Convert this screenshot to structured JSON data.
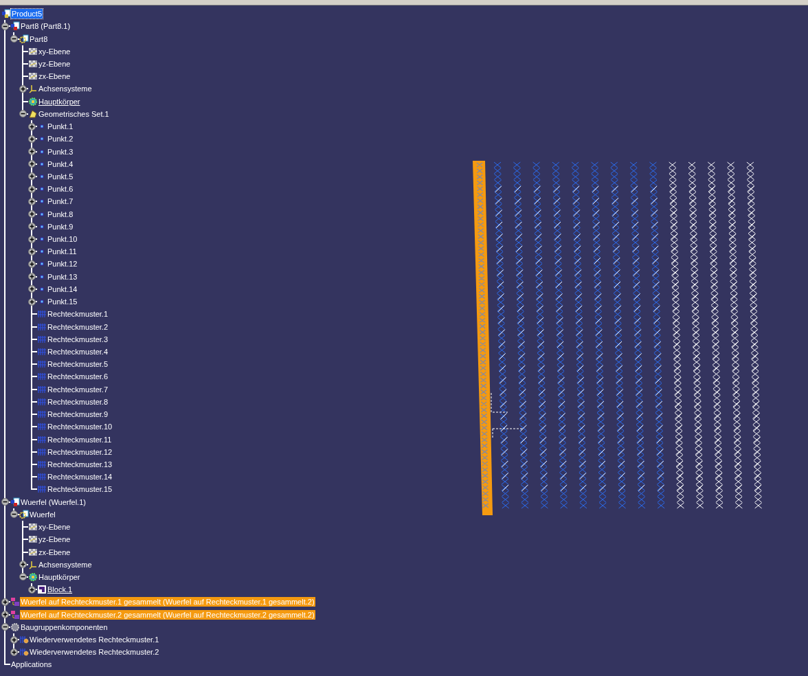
{
  "tree": [
    {
      "label": "Product5",
      "kind": "product",
      "selected": true,
      "children": [
        {
          "label": "Part8 (Part8.1)",
          "kind": "product-part",
          "expanded": true,
          "selected": false,
          "children": [
            {
              "label": "Part8",
              "kind": "part",
              "expanded": true,
              "selected": false,
              "children": [
                {
                  "label": "xy-Ebene",
                  "kind": "plane",
                  "selected": false
                },
                {
                  "label": "yz-Ebene",
                  "kind": "plane",
                  "selected": false
                },
                {
                  "label": "zx-Ebene",
                  "kind": "plane",
                  "selected": false
                },
                {
                  "label": "Achsensysteme",
                  "kind": "axis",
                  "expanded": false,
                  "selected": false
                },
                {
                  "label": "Hauptkörper",
                  "kind": "body",
                  "selected": false,
                  "underlined": true
                },
                {
                  "label": "Geometrisches Set.1",
                  "kind": "geoset",
                  "expanded": true,
                  "selected": false,
                  "children": [
                    {
                      "label": "Punkt.1",
                      "kind": "point",
                      "expanded": false,
                      "selected": false
                    },
                    {
                      "label": "Punkt.2",
                      "kind": "point",
                      "expanded": false,
                      "selected": false
                    },
                    {
                      "label": "Punkt.3",
                      "kind": "point",
                      "expanded": false,
                      "selected": false
                    },
                    {
                      "label": "Punkt.4",
                      "kind": "point",
                      "expanded": false,
                      "selected": false
                    },
                    {
                      "label": "Punkt.5",
                      "kind": "point",
                      "expanded": false,
                      "selected": false
                    },
                    {
                      "label": "Punkt.6",
                      "kind": "point",
                      "expanded": false,
                      "selected": false
                    },
                    {
                      "label": "Punkt.7",
                      "kind": "point",
                      "expanded": false,
                      "selected": false
                    },
                    {
                      "label": "Punkt.8",
                      "kind": "point",
                      "expanded": false,
                      "selected": false
                    },
                    {
                      "label": "Punkt.9",
                      "kind": "point",
                      "expanded": false,
                      "selected": false
                    },
                    {
                      "label": "Punkt.10",
                      "kind": "point",
                      "expanded": false,
                      "selected": false
                    },
                    {
                      "label": "Punkt.11",
                      "kind": "point",
                      "expanded": false,
                      "selected": false
                    },
                    {
                      "label": "Punkt.12",
                      "kind": "point",
                      "expanded": false,
                      "selected": false
                    },
                    {
                      "label": "Punkt.13",
                      "kind": "point",
                      "expanded": false,
                      "selected": false
                    },
                    {
                      "label": "Punkt.14",
                      "kind": "point",
                      "expanded": false,
                      "selected": false
                    },
                    {
                      "label": "Punkt.15",
                      "kind": "point",
                      "expanded": false,
                      "selected": false
                    },
                    {
                      "label": "Rechteckmuster.1",
                      "kind": "pattern",
                      "selected": false
                    },
                    {
                      "label": "Rechteckmuster.2",
                      "kind": "pattern",
                      "selected": false
                    },
                    {
                      "label": "Rechteckmuster.3",
                      "kind": "pattern",
                      "selected": false
                    },
                    {
                      "label": "Rechteckmuster.4",
                      "kind": "pattern",
                      "selected": false
                    },
                    {
                      "label": "Rechteckmuster.5",
                      "kind": "pattern",
                      "selected": false
                    },
                    {
                      "label": "Rechteckmuster.6",
                      "kind": "pattern",
                      "selected": false
                    },
                    {
                      "label": "Rechteckmuster.7",
                      "kind": "pattern",
                      "selected": false
                    },
                    {
                      "label": "Rechteckmuster.8",
                      "kind": "pattern",
                      "selected": false
                    },
                    {
                      "label": "Rechteckmuster.9",
                      "kind": "pattern",
                      "selected": false
                    },
                    {
                      "label": "Rechteckmuster.10",
                      "kind": "pattern",
                      "selected": false
                    },
                    {
                      "label": "Rechteckmuster.11",
                      "kind": "pattern",
                      "selected": false
                    },
                    {
                      "label": "Rechteckmuster.12",
                      "kind": "pattern",
                      "selected": false
                    },
                    {
                      "label": "Rechteckmuster.13",
                      "kind": "pattern",
                      "selected": false
                    },
                    {
                      "label": "Rechteckmuster.14",
                      "kind": "pattern",
                      "selected": false
                    },
                    {
                      "label": "Rechteckmuster.15",
                      "kind": "pattern",
                      "selected": false
                    }
                  ]
                }
              ]
            }
          ]
        },
        {
          "label": "Wuerfel (Wuerfel.1)",
          "kind": "product-part",
          "expanded": true,
          "selected": false,
          "children": [
            {
              "label": "Wuerfel",
              "kind": "part",
              "expanded": true,
              "selected": false,
              "children": [
                {
                  "label": "xy-Ebene",
                  "kind": "plane",
                  "selected": false
                },
                {
                  "label": "yz-Ebene",
                  "kind": "plane",
                  "selected": false
                },
                {
                  "label": "zx-Ebene",
                  "kind": "plane",
                  "selected": false
                },
                {
                  "label": "Achsensysteme",
                  "kind": "axis",
                  "expanded": false,
                  "selected": false
                },
                {
                  "label": "Hauptkörper",
                  "kind": "body",
                  "expanded": true,
                  "selected": false,
                  "children": [
                    {
                      "label": "Block.1",
                      "kind": "block",
                      "expanded": false,
                      "selected": false,
                      "underlined": true
                    }
                  ]
                }
              ]
            }
          ]
        },
        {
          "label": "Wuerfel auf Rechteckmuster.1 gesammelt (Wuerfel auf Rechteckmuster.1 gesammelt.2)",
          "kind": "assembly",
          "expanded": false,
          "selected": false,
          "highlighted": true
        },
        {
          "label": "Wuerfel auf Rechteckmuster.2 gesammelt (Wuerfel auf Rechteckmuster.2 gesammelt.2)",
          "kind": "assembly",
          "expanded": false,
          "selected": false,
          "highlighted": true
        },
        {
          "label": "Baugruppenkomponenten",
          "kind": "components",
          "expanded": true,
          "selected": false,
          "children": [
            {
              "label": "Wiederverwendetes Rechteckmuster.1",
              "kind": "reuse",
              "expanded": false,
              "selected": false
            },
            {
              "label": "Wiederverwendetes Rechteckmuster.2",
              "kind": "reuse",
              "expanded": false,
              "selected": false
            }
          ]
        },
        {
          "label": "Applications",
          "kind": "none",
          "selected": false
        }
      ]
    }
  ]
}
